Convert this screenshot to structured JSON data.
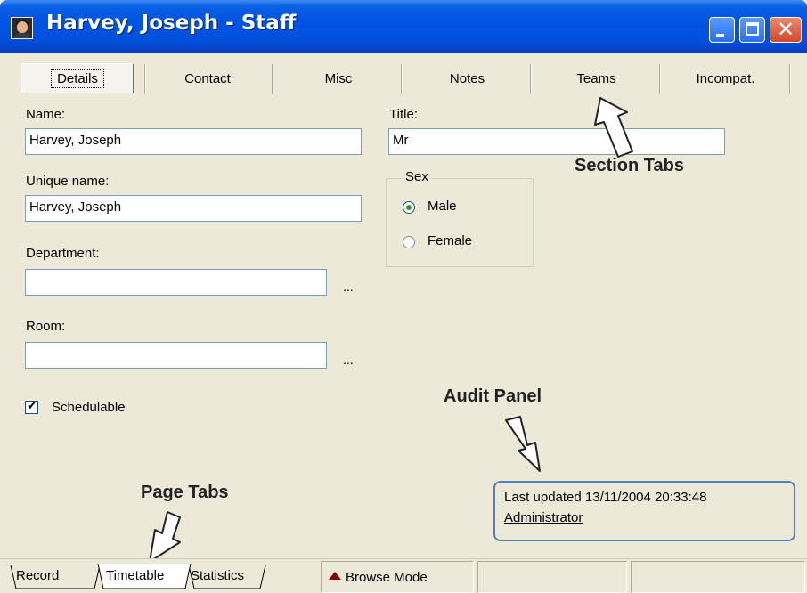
{
  "window": {
    "title": "Harvey, Joseph - Staff"
  },
  "section_tabs": [
    {
      "label": "Details",
      "active": true
    },
    {
      "label": "Contact",
      "active": false
    },
    {
      "label": "Misc",
      "active": false
    },
    {
      "label": "Notes",
      "active": false
    },
    {
      "label": "Teams",
      "active": false
    },
    {
      "label": "Incompat.",
      "active": false
    }
  ],
  "form": {
    "name_label": "Name:",
    "name_value": "Harvey, Joseph",
    "title_label": "Title:",
    "title_value": "Mr",
    "unique_name_label": "Unique name:",
    "unique_name_value": "Harvey, Joseph",
    "sex_label": "Sex",
    "sex_options": [
      {
        "label": "Male",
        "checked": true
      },
      {
        "label": "Female",
        "checked": false
      }
    ],
    "department_label": "Department:",
    "department_value": "",
    "room_label": "Room:",
    "room_value": "",
    "browse_button": "...",
    "schedulable_label": "Schedulable",
    "schedulable_checked": true
  },
  "audit": {
    "last_updated": "Last updated 13/11/2004 20:33:48",
    "user": "Administrator"
  },
  "annotations": {
    "section_tabs": "Section Tabs",
    "audit_panel": "Audit Panel",
    "page_tabs": "Page Tabs"
  },
  "page_tabs": [
    {
      "label": "Record"
    },
    {
      "label": "Timetable"
    },
    {
      "label": "Statistics"
    }
  ],
  "status": {
    "mode": "Browse Mode"
  },
  "colors": {
    "titlebar": "#0054e3",
    "window_bg": "#ece9d8",
    "field_border": "#7f9db9",
    "audit_border": "#4f81bd",
    "browse_indicator": "#8b0000"
  }
}
